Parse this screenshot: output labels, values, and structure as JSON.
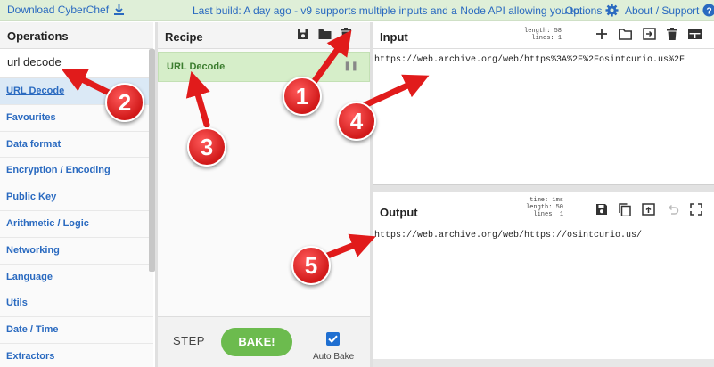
{
  "banner": {
    "download_label": "Download CyberChef",
    "build_text": "Last build: A day ago - v9 supports multiple inputs and a Node API allowing you to...",
    "options_label": "Options",
    "about_label": "About / Support"
  },
  "operations": {
    "title": "Operations",
    "search_value": "url decode",
    "items": [
      "URL Decode",
      "Favourites",
      "Data format",
      "Encryption / Encoding",
      "Public Key",
      "Arithmetic / Logic",
      "Networking",
      "Language",
      "Utils",
      "Date / Time",
      "Extractors"
    ]
  },
  "recipe": {
    "title": "Recipe",
    "op_label": "URL Decode",
    "step_label": "STEP",
    "bake_label": "BAKE!",
    "autobake_label": "Auto Bake"
  },
  "input": {
    "title": "Input",
    "stats": {
      "length_label": "length:",
      "length": "58",
      "lines_label": "lines:",
      "lines": "1"
    },
    "text": "https://web.archive.org/web/https%3A%2F%2Fosintcurio.us%2F"
  },
  "output": {
    "title": "Output",
    "stats": {
      "time_label": "time:",
      "time": "1ms",
      "length_label": "length:",
      "length": "50",
      "lines_label": "lines:",
      "lines": "1"
    },
    "text": "https://web.archive.org/web/https://osintcurio.us/"
  },
  "annotations": [
    "1",
    "2",
    "3",
    "4",
    "5"
  ],
  "colors": {
    "banner_bg": "#dfefd8",
    "link_blue": "#2a6ac0",
    "recipe_op_bg": "#d6eec9",
    "bake_green": "#6cbb4e",
    "marker_red": "#d11919"
  }
}
